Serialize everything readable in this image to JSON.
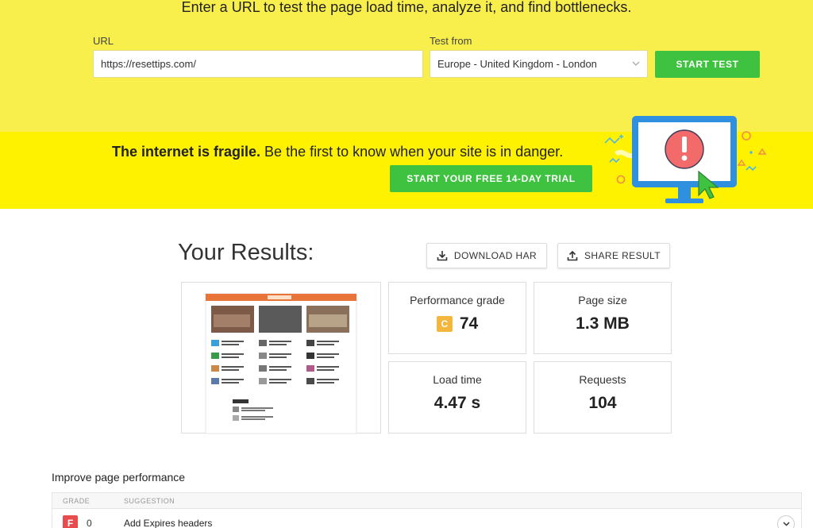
{
  "hero": {
    "tagline": "Enter a URL to test the page load time, analyze it, and find bottlenecks.",
    "url_label": "URL",
    "url_value": "https://resettips.com/",
    "location_label": "Test from",
    "location_value": "Europe - United Kingdom - London",
    "start_label": "START TEST"
  },
  "banner": {
    "bold_text": "The internet is fragile.",
    "rest_text": " Be the first to know when your site is in danger.",
    "trial_label": "START YOUR FREE 14-DAY TRIAL",
    "illustration_icon": "monitor-alert-icon"
  },
  "results": {
    "title": "Your Results:",
    "download_label": "DOWNLOAD HAR",
    "share_label": "SHARE RESULT",
    "metrics": {
      "grade_label": "Performance grade",
      "grade_letter": "C",
      "grade_value": "74",
      "size_label": "Page size",
      "size_value": "1.3 MB",
      "load_label": "Load time",
      "load_value": "4.47 s",
      "requests_label": "Requests",
      "requests_value": "104"
    }
  },
  "improve": {
    "title": "Improve page performance",
    "headers": {
      "grade": "GRADE",
      "suggestion": "SUGGESTION"
    },
    "rows": [
      {
        "grade_letter": "F",
        "score": "0",
        "suggestion": "Add Expires headers"
      }
    ]
  },
  "colors": {
    "hero_bg": "#f8ee4c",
    "banner_bg": "#fff200",
    "green": "#3fc23f",
    "grade_c": "#f4b63c",
    "grade_f": "#e84c4c"
  }
}
